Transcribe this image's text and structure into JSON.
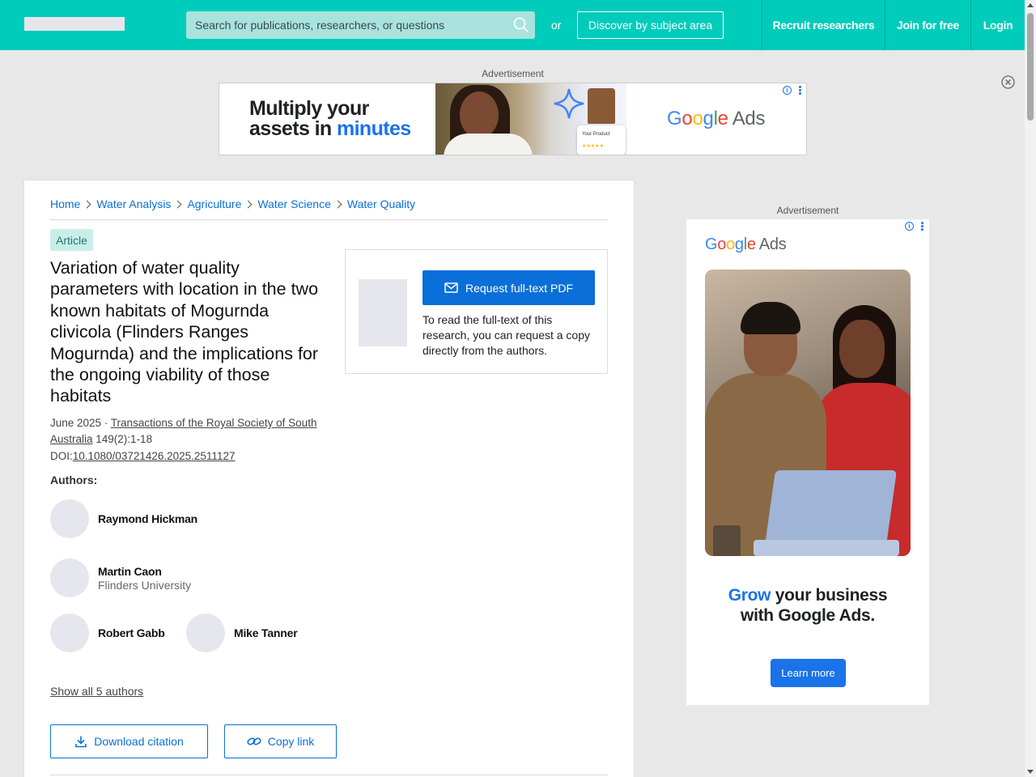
{
  "header": {
    "search_placeholder": "Search for publications, researchers, or questions",
    "or_text": "or",
    "discover_label": "Discover by subject area",
    "nav": [
      "Recruit researchers",
      "Join for free",
      "Login"
    ]
  },
  "ads": {
    "label": "Advertisement",
    "top": {
      "headline_line1": "Multiply your",
      "headline_line2_a": "assets in ",
      "headline_line2_b": "minutes",
      "card_text": "Your Product",
      "card_stars": "★★★★★"
    },
    "side": {
      "headline_a": "Grow",
      "headline_b": " your business",
      "headline_line2": "with Google Ads.",
      "cta": "Learn more"
    },
    "google_ads_text": {
      "g1": "G",
      "o1": "o",
      "o2": "o",
      "g2": "g",
      "l": "l",
      "e": "e",
      "ads": " Ads"
    }
  },
  "breadcrumb": [
    "Home",
    "Water Analysis",
    "Agriculture",
    "Water Science",
    "Water Quality"
  ],
  "article": {
    "type": "Article",
    "title": "Variation of water quality parameters with location in the two known habitats of Mogurnda clivicola (Flinders Ranges Mogurnda) and the implications for the ongoing viability of those habitats",
    "date": "June 2025 · ",
    "journal": "Transactions of the Royal Society of South Australia",
    "volume": " 149(2):1-18",
    "doi_label": "DOI:",
    "doi": "10.1080/03721426.2025.2511127",
    "authors_label": "Authors:",
    "authors": [
      {
        "name": "Raymond Hickman",
        "affiliation": ""
      },
      {
        "name": "Martin Caon",
        "affiliation": "Flinders University"
      },
      {
        "name": "Robert Gabb",
        "affiliation": ""
      },
      {
        "name": "Mike Tanner",
        "affiliation": ""
      }
    ],
    "show_all": "Show all 5 authors",
    "download_citation": "Download citation",
    "copy_link": "Copy link"
  },
  "request": {
    "button": "Request full-text PDF",
    "text": "To read the full-text of this research, you can request a copy directly from the authors."
  },
  "colors": {
    "brand": "#00ccbb",
    "link": "#0a6fd8",
    "badge_bg": "#c9eeea"
  }
}
